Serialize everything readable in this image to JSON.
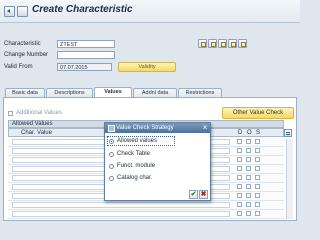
{
  "window": {
    "title": "Create Characteristic"
  },
  "header": {
    "characteristic": {
      "label": "Characteristic",
      "value": "ZTEST"
    },
    "change_number": {
      "label": "Change Number",
      "value": ""
    },
    "valid_from": {
      "label": "Valid From",
      "value": "07.07.2015"
    },
    "validity_button": "Validity",
    "toolbar_icons": [
      "edit-icon",
      "copy-icon",
      "details-icon",
      "document-icon",
      "print-icon"
    ]
  },
  "tabs": [
    {
      "label": "Basic data",
      "active": false
    },
    {
      "label": "Descriptions",
      "active": false
    },
    {
      "label": "Values",
      "active": true
    },
    {
      "label": "Addnl data",
      "active": false
    },
    {
      "label": "Restrictions",
      "active": false
    }
  ],
  "values_tab": {
    "additional_values_label": "Additional Values",
    "other_value_check_button": "Other Value Check",
    "allowed_values_header": "Allowed Values",
    "columns": {
      "char_value": "Char. Value",
      "d": "D",
      "o": "O",
      "s": "S"
    }
  },
  "dialog": {
    "title": "Value Check Strategy",
    "options": [
      {
        "label": "Allowed values",
        "selected": true
      },
      {
        "label": "Check Table",
        "selected": false
      },
      {
        "label": "Funct. module",
        "selected": false
      },
      {
        "label": "Catalog char.",
        "selected": false
      }
    ],
    "confirm_symbol": "✔",
    "cancel_symbol": "✖"
  },
  "colors": {
    "accent_yellow": "#f3d96b",
    "dialog_title": "#4d7098",
    "confirm_green": "#2f8a2f",
    "cancel_red": "#b3261e"
  }
}
